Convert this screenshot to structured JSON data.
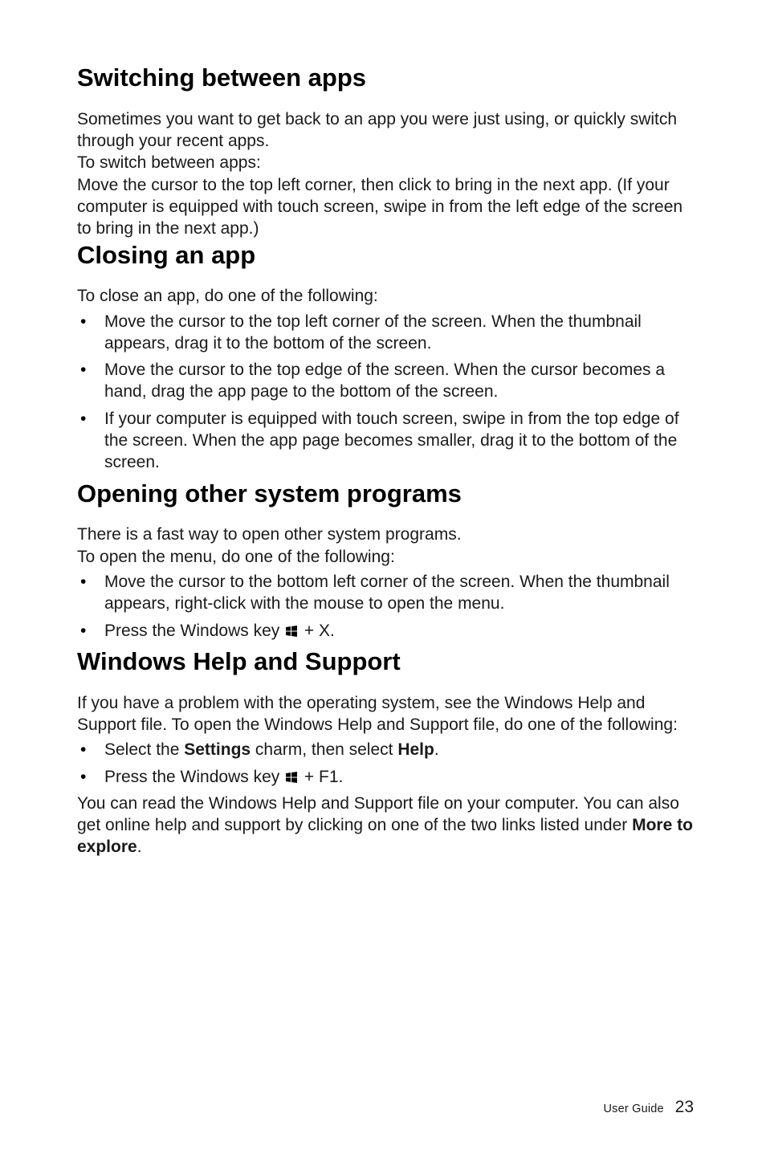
{
  "sections": [
    {
      "id": "switching",
      "title": "Switching between apps",
      "paras": [
        "Sometimes you want to get back to an app you were just using, or quickly switch through your recent apps.",
        "To switch between apps:",
        "Move the cursor to the top left corner, then click to bring in the next app. (If your computer is equipped with touch screen, swipe in from the left edge of the screen to bring in the next app.)"
      ]
    },
    {
      "id": "closing",
      "title": "Closing an app",
      "intro": "To close an app, do one of the following:",
      "bullets": [
        "Move the cursor to the top left corner of the screen. When the thumbnail appears, drag it to the bottom of the screen.",
        "Move the cursor to the top edge of the screen. When the cursor becomes a hand, drag the app page to the bottom of the screen.",
        "If your computer is equipped with touch screen, swipe in from the top edge of the screen. When the app page becomes smaller, drag it to the bottom of the screen."
      ]
    },
    {
      "id": "opening",
      "title": "Opening other system programs",
      "paras": [
        "There is a fast way to open other system programs.",
        "To open the menu, do one of the following:"
      ],
      "bullets": [
        "Move the cursor to the bottom left corner of the screen. When the thumbnail appears, right-click with the mouse to open the menu."
      ],
      "win_bullet": {
        "prefix": "Press the Windows key ",
        "suffix": " + X."
      }
    },
    {
      "id": "help",
      "title": "Windows Help and Support",
      "intro": "If you have a problem with the operating system, see the Windows Help and Support file. To open the Windows Help and Support file, do one of the following:",
      "bullet_parts": {
        "p1": "Select the ",
        "b1": "Settings",
        "p2": " charm, then select ",
        "b2": "Help",
        "p3": "."
      },
      "win_bullet": {
        "prefix": "Press the Windows key ",
        "suffix": " + F1."
      },
      "outro_parts": {
        "p1": "You can read the Windows Help and Support file on your computer. You can also get online help and support by clicking on one of the two links listed under ",
        "b1": "More to explore",
        "p2": "."
      }
    }
  ],
  "footer": {
    "label": "User Guide",
    "page": "23"
  }
}
